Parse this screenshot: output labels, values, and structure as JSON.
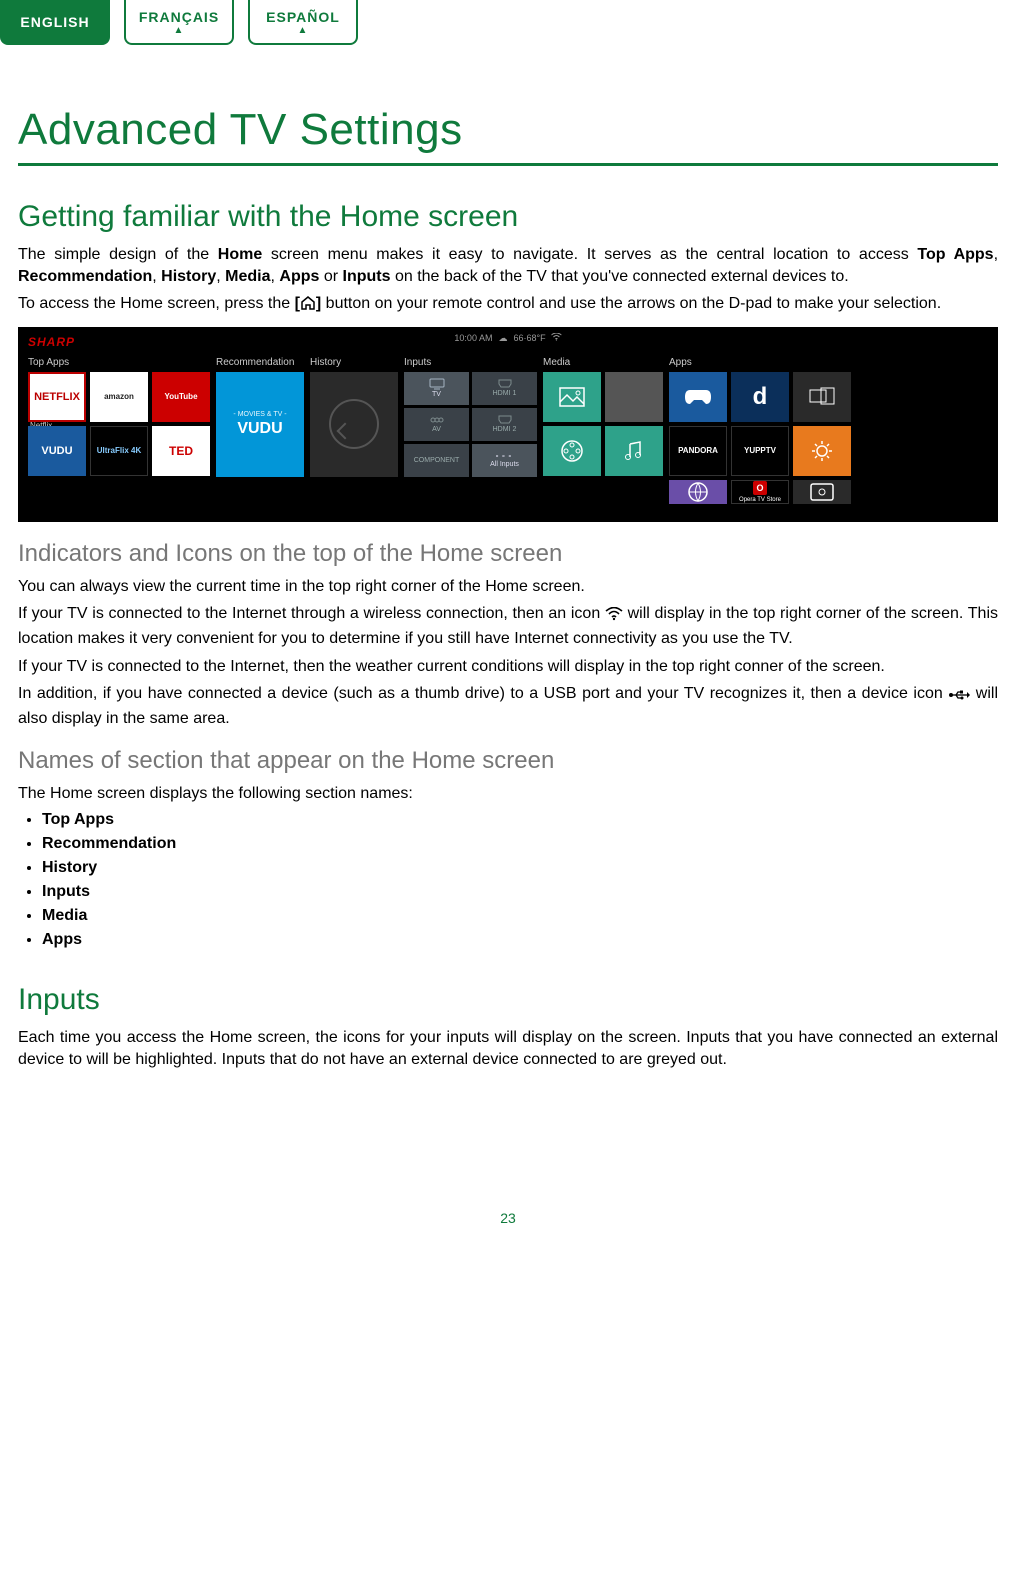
{
  "lang_tabs": {
    "english": "ENGLISH",
    "francais": "FRANÇAIS",
    "espanol": "ESPAÑOL"
  },
  "title": "Advanced TV Settings",
  "s1": {
    "heading": "Getting familiar with the Home screen",
    "p1a": "The simple design of the ",
    "p1_home": "Home",
    "p1b": " screen menu makes it easy to navigate. It serves as the central location to access ",
    "p1_topapps": "Top Apps",
    "p1c": ", ",
    "p1_rec": "Recommendation",
    "p1d": ", ",
    "p1_hist": "History",
    "p1e": ", ",
    "p1_media": "Media",
    "p1f": ", ",
    "p1_apps": "Apps",
    "p1g": " or ",
    "p1_inputs": "Inputs",
    "p1h": " on the back of the TV that you've connected external devices to.",
    "p2a": "To access the Home screen, press the ",
    "p2b": " button on your remote control and use the arrows on the D-pad to make your selection."
  },
  "tv": {
    "brand": "SHARP",
    "time": "10:00 AM",
    "temp": "66·68°F",
    "sections": {
      "topapps": "Top Apps",
      "rec": "Recommendation",
      "history": "History",
      "inputs": "Inputs",
      "media": "Media",
      "apps": "Apps"
    },
    "apps_top": {
      "netflix": "NETFLIX",
      "netflix_cap": "Netflix",
      "amazon": "amazon",
      "youtube": "YouTube",
      "vudu": "VUDU",
      "ultra": "UltraFlix 4K",
      "ted": "TED"
    },
    "rec_tile": {
      "sub": "- MOVIES & TV -",
      "main": "VUDU"
    },
    "inputs": {
      "tv": "TV",
      "hdmi1": "HDMI 1",
      "av": "AV",
      "hdmi2": "HDMI 2",
      "component": "COMPONENT",
      "all": "All Inputs"
    },
    "apps_right": {
      "pandora": "PANDORA",
      "yupp": "YUPPTV",
      "accu": "AccuWeather",
      "opera": "Opera TV Store"
    }
  },
  "s2": {
    "heading": "Indicators and Icons on the top of the Home screen",
    "p1": "You can always view the current time in the top right corner of the Home screen.",
    "p2a": "If your TV is connected to the Internet through a wireless connection, then an icon ",
    "p2b": " will display in the top right corner of the screen. This location makes it very convenient for you to determine if you still have Internet connectivity as you use the TV.",
    "p3": "If your TV is connected to the Internet, then the weather current conditions will display in the top right conner of the screen.",
    "p4a": "In addition, if you have connected a device (such as a thumb drive) to a USB port and your TV recognizes it, then a device icon ",
    "p4b": " will also display in the same area."
  },
  "s3": {
    "heading": "Names of section that appear on the Home screen",
    "intro": "The Home screen displays the following section names:",
    "items": [
      "Top Apps",
      "Recommendation",
      "History",
      "Inputs",
      "Media",
      "Apps"
    ]
  },
  "s4": {
    "heading": "Inputs",
    "p1": "Each time you access the Home screen, the icons for your inputs will display on the screen. Inputs that you have connected an external device to will be highlighted. Inputs that do not have an external device connected to are greyed out."
  },
  "page_number": "23"
}
